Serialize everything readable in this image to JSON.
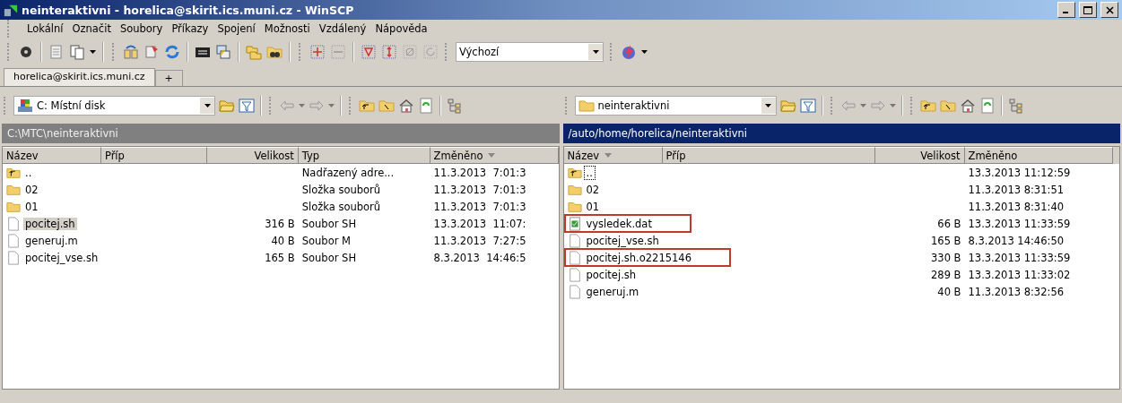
{
  "window": {
    "title": "neinteraktivni - horelica@skirit.ics.muni.cz - WinSCP"
  },
  "menu": [
    "Lokální",
    "Označit",
    "Soubory",
    "Příkazy",
    "Spojení",
    "Možnosti",
    "Vzdálený",
    "Nápověda"
  ],
  "toolbar": {
    "preset": "Výchozí"
  },
  "tabs": [
    {
      "label": "horelica@skirit.ics.muni.cz",
      "selected": true
    },
    {
      "label": "+",
      "selected": false
    }
  ],
  "panels": [
    {
      "location": "C: Místní disk",
      "path": "C:\\MTC\\neinteraktivni",
      "active": false,
      "columns": [
        {
          "label": "Název",
          "sorted": false
        },
        {
          "label": "Příp",
          "sorted": false
        },
        {
          "label": "Velikost",
          "sorted": false
        },
        {
          "label": "Typ",
          "sorted": false
        },
        {
          "label": "Změněno",
          "sorted": true
        }
      ],
      "rows": [
        {
          "kind": "parent",
          "name": "..",
          "size": "",
          "type": "Nadřazený adre...",
          "date": "11.3.2013  7:01:3",
          "selected": false,
          "focused": false,
          "highlighted": false
        },
        {
          "kind": "folder",
          "name": "02",
          "size": "",
          "type": "Složka souborů",
          "date": "11.3.2013  7:01:3",
          "selected": false,
          "focused": false,
          "highlighted": false
        },
        {
          "kind": "folder",
          "name": "01",
          "size": "",
          "type": "Složka souborů",
          "date": "11.3.2013  7:01:3",
          "selected": false,
          "focused": false,
          "highlighted": false
        },
        {
          "kind": "file",
          "name": "pocitej.sh",
          "size": "316 B",
          "type": "Soubor SH",
          "date": "13.3.2013  11:07:",
          "selected": true,
          "focused": false,
          "highlighted": false
        },
        {
          "kind": "file",
          "name": "generuj.m",
          "size": "40 B",
          "type": "Soubor M",
          "date": "11.3.2013  7:27:5",
          "selected": false,
          "focused": false,
          "highlighted": false
        },
        {
          "kind": "file",
          "name": "pocitej_vse.sh",
          "size": "165 B",
          "type": "Soubor SH",
          "date": "8.3.2013  14:46:5",
          "selected": false,
          "focused": false,
          "highlighted": false
        }
      ]
    },
    {
      "location": "neinteraktivni",
      "path": "/auto/home/horelica/neinteraktivni",
      "active": true,
      "columns": [
        {
          "label": "Název",
          "sorted": true
        },
        {
          "label": "Příp",
          "sorted": false
        },
        {
          "label": "Velikost",
          "sorted": false
        },
        {
          "label": "Změněno",
          "sorted": false
        }
      ],
      "rows": [
        {
          "kind": "parent",
          "name": "..",
          "size": "",
          "date": "13.3.2013 11:12:59",
          "selected": false,
          "focused": true,
          "highlighted": false
        },
        {
          "kind": "folder",
          "name": "02",
          "size": "",
          "date": "11.3.2013 8:31:51",
          "selected": false,
          "focused": false,
          "highlighted": false
        },
        {
          "kind": "folder",
          "name": "01",
          "size": "",
          "date": "11.3.2013 8:31:40",
          "selected": false,
          "focused": false,
          "highlighted": false
        },
        {
          "kind": "data",
          "name": "vysledek.dat",
          "size": "66 B",
          "date": "13.3.2013 11:33:59",
          "selected": false,
          "focused": false,
          "highlighted": true
        },
        {
          "kind": "file",
          "name": "pocitej_vse.sh",
          "size": "165 B",
          "date": "8.3.2013 14:46:50",
          "selected": false,
          "focused": false,
          "highlighted": false
        },
        {
          "kind": "file",
          "name": "pocitej.sh.o2215146",
          "size": "330 B",
          "date": "13.3.2013 11:33:59",
          "selected": false,
          "focused": false,
          "highlighted": true
        },
        {
          "kind": "file",
          "name": "pocitej.sh",
          "size": "289 B",
          "date": "13.3.2013 11:33:02",
          "selected": false,
          "focused": false,
          "highlighted": false
        },
        {
          "kind": "file",
          "name": "generuj.m",
          "size": "40 B",
          "date": "11.3.2013 8:32:56",
          "selected": false,
          "focused": false,
          "highlighted": false
        }
      ]
    }
  ]
}
